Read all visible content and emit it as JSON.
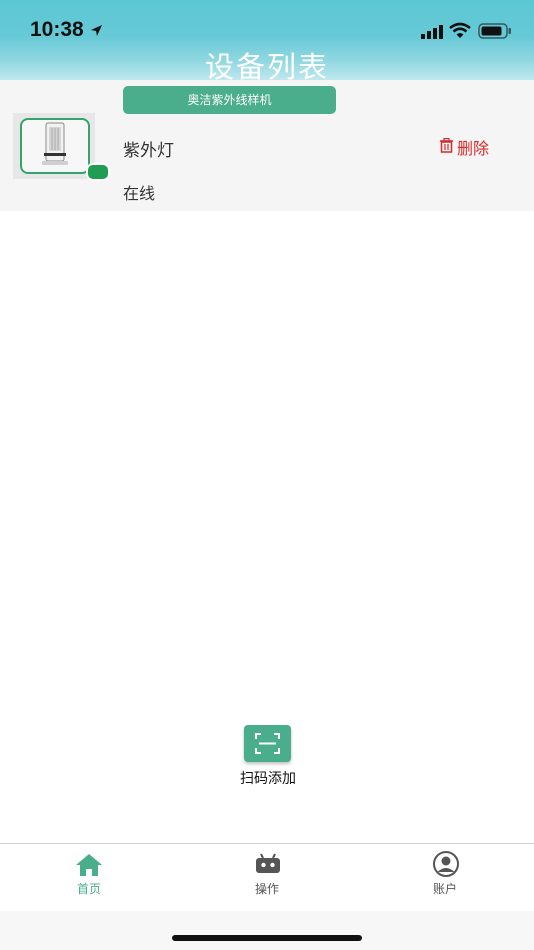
{
  "status_bar": {
    "time": "10:38"
  },
  "header": {
    "title": "设备列表"
  },
  "device": {
    "name": "奥洁紫外线样机",
    "type": "紫外灯",
    "status": "在线",
    "delete_label": "删除",
    "online_color": "#1f9d55"
  },
  "scan": {
    "label": "扫码添加"
  },
  "tabs": [
    {
      "label": "首页",
      "icon": "home-icon",
      "active": true
    },
    {
      "label": "操作",
      "icon": "robot-icon",
      "active": false
    },
    {
      "label": "账户",
      "icon": "account-icon",
      "active": false
    }
  ],
  "colors": {
    "accent": "#4aad8c",
    "danger": "#d82a2a",
    "header": "#66c9d6"
  }
}
